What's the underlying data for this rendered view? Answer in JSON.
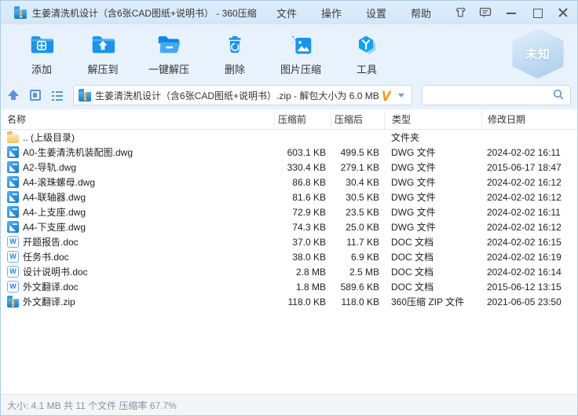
{
  "titlebar": {
    "title": "生姜清洗机设计（含6张CAD图纸+说明书） - 360压缩",
    "menus": [
      "文件",
      "操作",
      "设置",
      "帮助"
    ]
  },
  "toolbar": {
    "buttons": [
      {
        "label": "添加",
        "icon": "add-folder-icon"
      },
      {
        "label": "解压到",
        "icon": "extract-to-folder-icon"
      },
      {
        "label": "一键解压",
        "icon": "one-click-extract-icon"
      },
      {
        "label": "删除",
        "icon": "delete-trash-icon"
      },
      {
        "label": "图片压缩",
        "icon": "image-compress-icon"
      },
      {
        "label": "工具",
        "icon": "tools-hexagon-icon"
      }
    ],
    "badge_label": "未知"
  },
  "addressbar": {
    "archive_label": "生姜清洗机设计（含6张CAD图纸+说明书）.zip - 解包大小为 6.0 MB",
    "vip_mark": "V",
    "search_value": "",
    "search_placeholder": ""
  },
  "table": {
    "headers": [
      "名称",
      "压缩前",
      "压缩后",
      "类型",
      "修改日期"
    ],
    "rows": [
      {
        "icon": "folder",
        "name": ".. (上级目录)",
        "before": "",
        "after": "",
        "type": "文件夹",
        "date": ""
      },
      {
        "icon": "dwg",
        "name": "A0-生姜清洗机装配图.dwg",
        "before": "603.1 KB",
        "after": "499.5 KB",
        "type": "DWG 文件",
        "date": "2024-02-02 16:11"
      },
      {
        "icon": "dwg",
        "name": "A2-导轨.dwg",
        "before": "330.4 KB",
        "after": "279.1 KB",
        "type": "DWG 文件",
        "date": "2015-06-17 18:47"
      },
      {
        "icon": "dwg",
        "name": "A4-滚珠螺母.dwg",
        "before": "86.8 KB",
        "after": "30.4 KB",
        "type": "DWG 文件",
        "date": "2024-02-02 16:12"
      },
      {
        "icon": "dwg",
        "name": "A4-联轴器.dwg",
        "before": "81.6 KB",
        "after": "30.5 KB",
        "type": "DWG 文件",
        "date": "2024-02-02 16:12"
      },
      {
        "icon": "dwg",
        "name": "A4-上支座.dwg",
        "before": "72.9 KB",
        "after": "23.5 KB",
        "type": "DWG 文件",
        "date": "2024-02-02 16:11"
      },
      {
        "icon": "dwg",
        "name": "A4-下支座.dwg",
        "before": "74.3 KB",
        "after": "25.0 KB",
        "type": "DWG 文件",
        "date": "2024-02-02 16:12"
      },
      {
        "icon": "doc",
        "name": "开题报告.doc",
        "before": "37.0 KB",
        "after": "11.7 KB",
        "type": "DOC 文档",
        "date": "2024-02-02 16:15"
      },
      {
        "icon": "doc",
        "name": "任务书.doc",
        "before": "38.0 KB",
        "after": "6.9 KB",
        "type": "DOC 文档",
        "date": "2024-02-02 16:19"
      },
      {
        "icon": "doc",
        "name": "设计说明书.doc",
        "before": "2.8 MB",
        "after": "2.5 MB",
        "type": "DOC 文档",
        "date": "2024-02-02 16:14"
      },
      {
        "icon": "doc",
        "name": "外文翻译.doc",
        "before": "1.8 MB",
        "after": "589.6 KB",
        "type": "DOC 文档",
        "date": "2015-06-12 13:15"
      },
      {
        "icon": "zip",
        "name": "外文翻译.zip",
        "before": "118.0 KB",
        "after": "118.0 KB",
        "type": "360压缩 ZIP 文件",
        "date": "2021-06-05 23:50"
      }
    ]
  },
  "statusbar": {
    "text": "大小: 4.1 MB 共 11 个文件 压缩率 67.7%"
  },
  "colors": {
    "accent_blue": "#1893f2",
    "titlebar_bg": "#d8e8f9",
    "toolbar_bg": "#e8f2fd",
    "statusbar_text": "#8b929c",
    "vip_orange": "#ff9d00"
  }
}
